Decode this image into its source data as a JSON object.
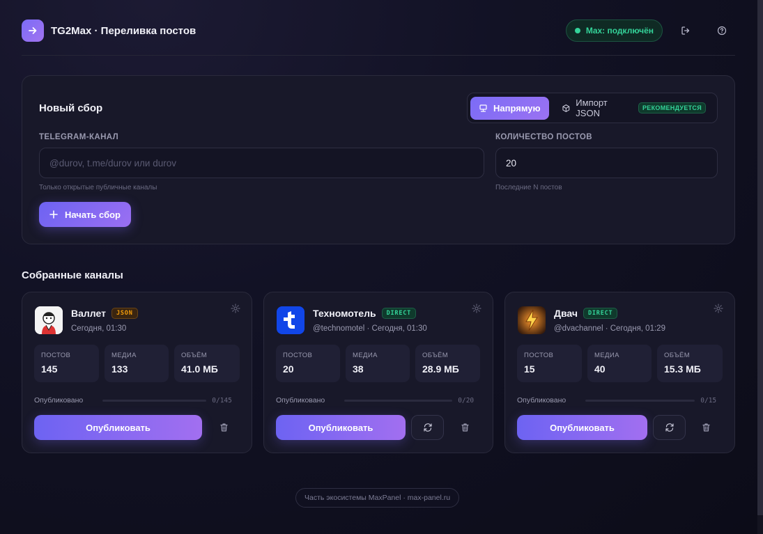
{
  "header": {
    "title": "TG2Max · Переливка постов",
    "status": "Max: подключён",
    "colors": {
      "accent": "#7b6cf6",
      "success": "#34d399"
    }
  },
  "new_collection": {
    "title": "Новый сбор",
    "mode_direct": "Напрямую",
    "mode_import": "Импорт JSON",
    "mode_import_badge": "РЕКОМЕНДУЕТСЯ",
    "channel_label": "TELEGRAM-КАНАЛ",
    "channel_placeholder": "@durov, t.me/durov или durov",
    "channel_hint": "Только открытые публичные каналы",
    "count_label": "КОЛИЧЕСТВО ПОСТОВ",
    "count_value": "20",
    "count_hint": "Последние N постов",
    "start_button": "Начать сбор"
  },
  "collected": {
    "title": "Собранные каналы",
    "stat_labels": {
      "posts": "ПОСТОВ",
      "media": "МЕДИА",
      "size": "ОБЪЁМ"
    },
    "published_label": "Опубликовано",
    "publish_button": "Опубликовать",
    "channels": [
      {
        "name": "Валлет",
        "badge": "JSON",
        "subtitle": "Сегодня, 01:30",
        "posts": "145",
        "media": "133",
        "size": "41.0 МБ",
        "progress": "0/145",
        "progress_fraction": 0
      },
      {
        "name": "Техномотель",
        "badge": "DIRECT",
        "subtitle": "@technomotel · Сегодня, 01:30",
        "posts": "20",
        "media": "38",
        "size": "28.9 МБ",
        "progress": "0/20",
        "progress_fraction": 0
      },
      {
        "name": "Двач",
        "badge": "DIRECT",
        "subtitle": "@dvachannel · Сегодня, 01:29",
        "posts": "15",
        "media": "40",
        "size": "15.3 МБ",
        "progress": "0/15",
        "progress_fraction": 0
      }
    ]
  },
  "footer": {
    "text": "Часть экосистемы MaxPanel · max-panel.ru"
  }
}
